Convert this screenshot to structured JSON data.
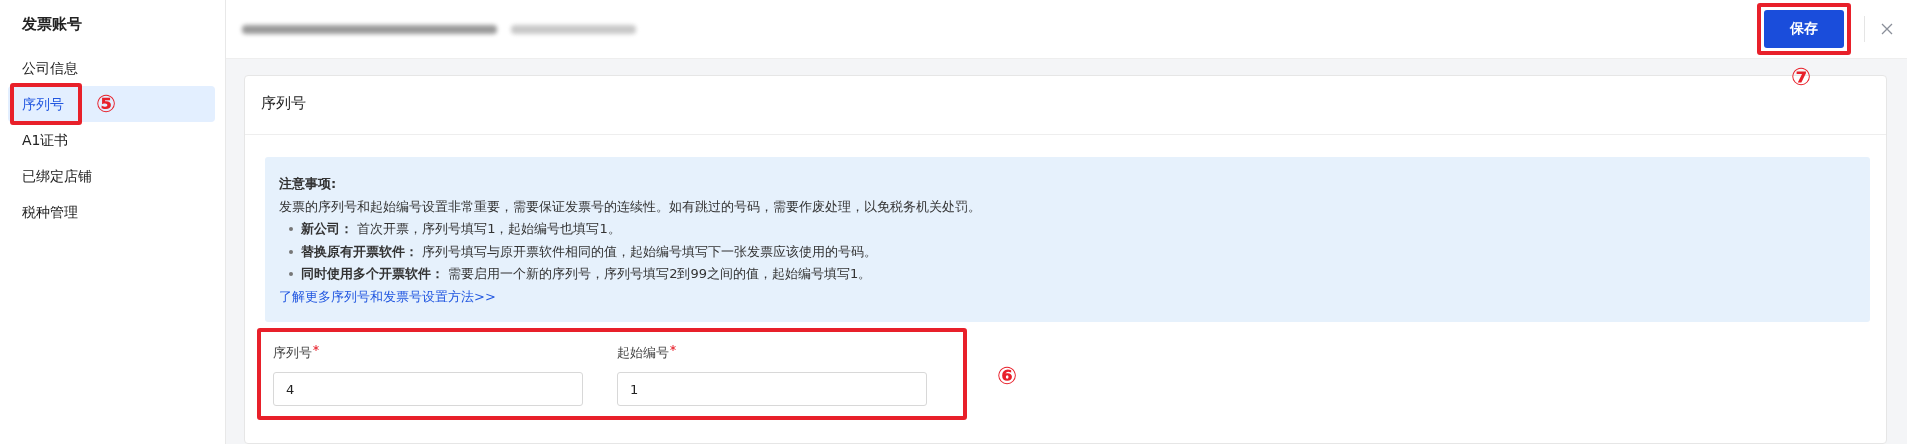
{
  "sidebar": {
    "title": "发票账号",
    "items": [
      {
        "label": "公司信息",
        "selected": false
      },
      {
        "label": "序列号",
        "selected": true,
        "annotation": "⑤"
      },
      {
        "label": "A1证书",
        "selected": false
      },
      {
        "label": "已绑定店铺",
        "selected": false
      },
      {
        "label": "税种管理",
        "selected": false
      }
    ]
  },
  "header": {
    "save_button": "保存",
    "save_annotation": "⑦"
  },
  "card": {
    "title": "序列号",
    "notice": {
      "heading": "注意事项:",
      "text": "发票的序列号和起始编号设置非常重要，需要保证发票号的连续性。如有跳过的号码，需要作废处理，以免税务机关处罚。",
      "bullets": [
        "**新公司：** 首次开票，序列号填写1，起始编号也填写1。",
        "**替换原有开票软件：** 序列号填写与原开票软件相同的值，起始编号填写下一张发票应该使用的号码。",
        "**同时使用多个开票软件：** 需要启用一个新的序列号，序列号填写2到99之间的值，起始编号填写1。"
      ],
      "link": "了解更多序列号和发票号设置方法>>"
    },
    "fields": [
      {
        "label": "序列号",
        "required": true,
        "value": "4"
      },
      {
        "label": "起始编号",
        "required": true,
        "value": "1"
      }
    ],
    "form_annotation": "⑥"
  }
}
